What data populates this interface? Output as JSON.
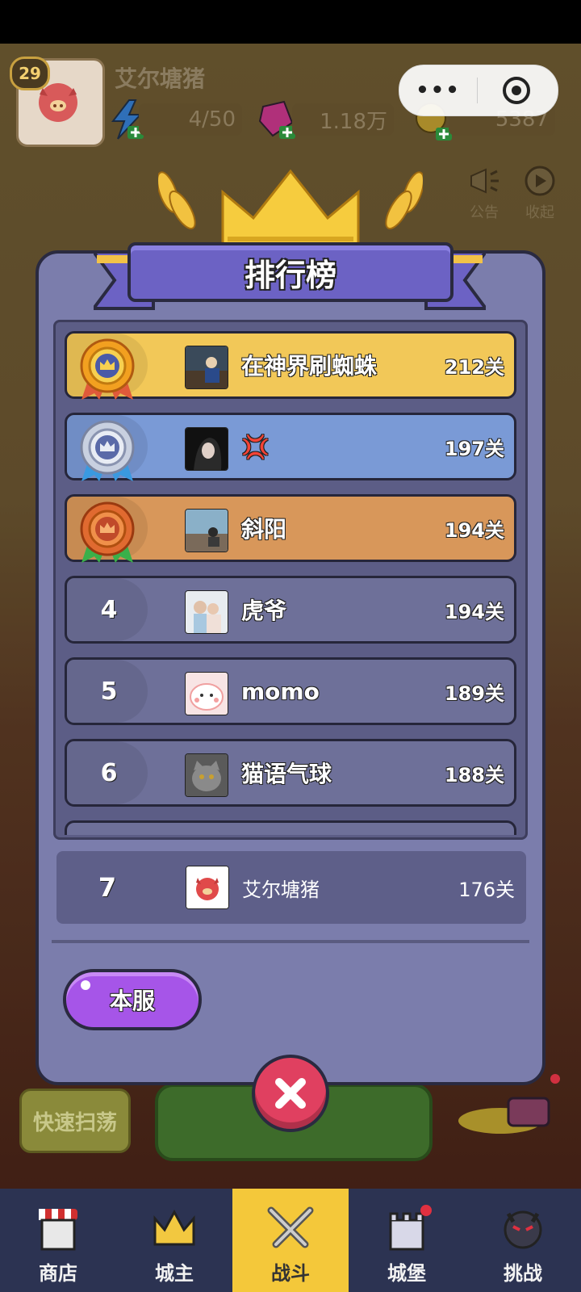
{
  "hud": {
    "player_level": "29",
    "player_name": "艾尔塘猪",
    "energy": "4/50",
    "gems": "1.18万",
    "coins": "5387",
    "announce_label": "公告",
    "collapse_label": "收起",
    "quick_sweep_label": "快速扫荡",
    "capsule_more": "•••"
  },
  "leaderboard": {
    "title": "排行榜",
    "rows": [
      {
        "rank": "1",
        "name": "在神界刷蜘蛛",
        "level": "212关",
        "style": "gold"
      },
      {
        "rank": "2",
        "name": "💢",
        "level": "197关",
        "style": "silver"
      },
      {
        "rank": "3",
        "name": "斜阳",
        "level": "194关",
        "style": "bronze"
      },
      {
        "rank": "4",
        "name": "虎爷",
        "level": "194关",
        "style": "plain"
      },
      {
        "rank": "5",
        "name": "momo",
        "level": "189关",
        "style": "plain"
      },
      {
        "rank": "6",
        "name": "猫语气球",
        "level": "188关",
        "style": "plain"
      }
    ],
    "my_row": {
      "rank": "7",
      "name": "艾尔塘猪",
      "level": "176关"
    },
    "server_button": "本服"
  },
  "bottom_nav": {
    "items": [
      {
        "label": "商店",
        "active": false
      },
      {
        "label": "城主",
        "active": false
      },
      {
        "label": "战斗",
        "active": true
      },
      {
        "label": "城堡",
        "active": false
      },
      {
        "label": "挑战",
        "active": false
      }
    ]
  },
  "colors": {
    "gold": "#f2c858",
    "silver": "#7a9ad6",
    "bronze": "#d8975a",
    "plain": "#6e7099",
    "panel": "#7b7dac",
    "title_bar": "#6c62c4",
    "server_button": "#a655e8",
    "close_button": "#e04060"
  }
}
